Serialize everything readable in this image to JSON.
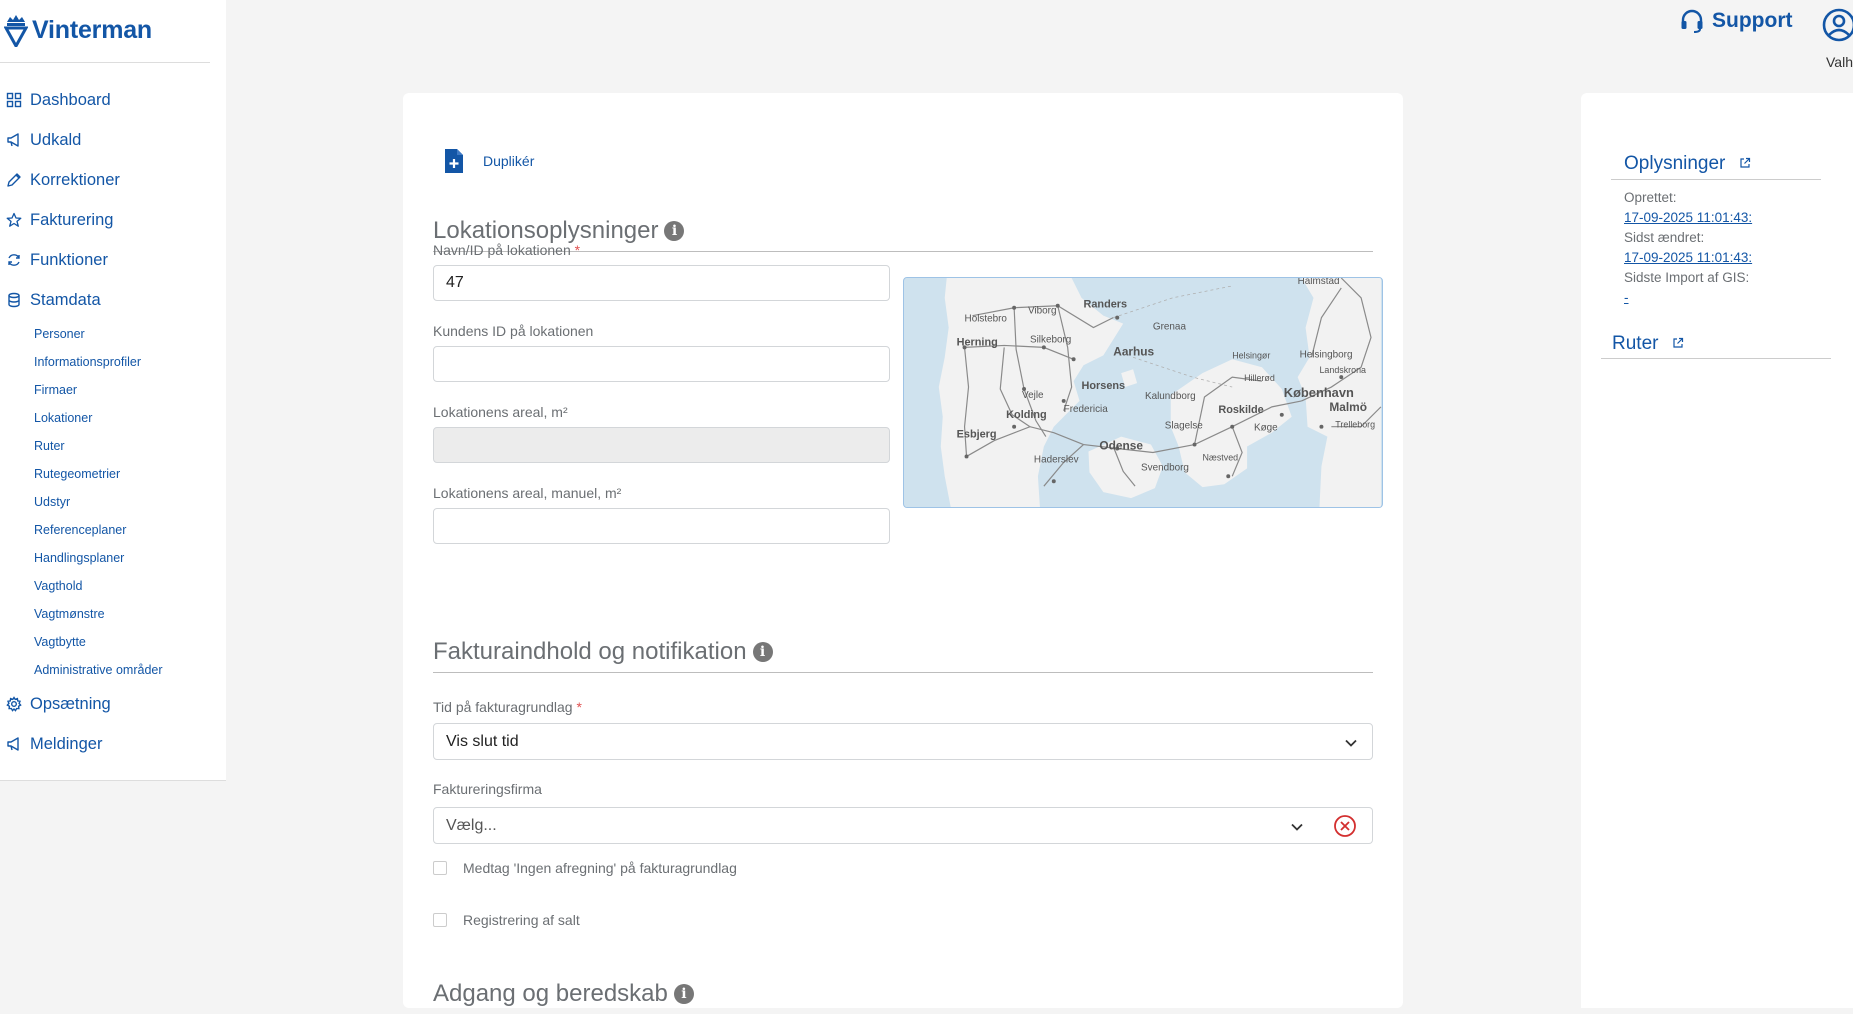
{
  "brand": {
    "name": "Vinterman",
    "color": "#1356a6"
  },
  "header": {
    "support_label": "Support",
    "user_name": "Valh"
  },
  "sidebar": {
    "items": [
      {
        "label": "Dashboard",
        "icon": "grid-icon"
      },
      {
        "label": "Udkald",
        "icon": "megaphone-icon"
      },
      {
        "label": "Korrektioner",
        "icon": "pencil-icon"
      },
      {
        "label": "Fakturering",
        "icon": "star-icon"
      },
      {
        "label": "Funktioner",
        "icon": "refresh-icon"
      },
      {
        "label": "Stamdata",
        "icon": "database-icon"
      }
    ],
    "sub_items": [
      "Personer",
      "Informationsprofiler",
      "Firmaer",
      "Lokationer",
      "Ruter",
      "Rutegeometrier",
      "Udstyr",
      "Referenceplaner",
      "Handlingsplaner",
      "Vagthold",
      "Vagtmønstre",
      "Vagtbytte",
      "Administrative områder"
    ],
    "bottom_items": [
      {
        "label": "Opsætning",
        "icon": "gear-icon"
      },
      {
        "label": "Meldinger",
        "icon": "megaphone-icon"
      }
    ]
  },
  "main": {
    "duplicate_label": "Duplikér",
    "location_section": {
      "title": "Lokationsoplysninger"
    },
    "fields": {
      "name_label": "Navn/ID på lokationen",
      "name_value": "47",
      "customer_id_label": "Kundens ID på lokationen",
      "customer_id_value": "",
      "area_label": "Lokationens areal, m²",
      "area_value": "",
      "area_manual_label": "Lokationens areal, manuel, m²",
      "area_manual_value": ""
    },
    "map_labels": [
      "Halmstad",
      "Holstebro",
      "Viborg",
      "Randers",
      "Grenaa",
      "Herning",
      "Silkeborg",
      "Aarhus",
      "Helsingør",
      "Helsingborg",
      "Hillerød",
      "Landskrona",
      "Horsens",
      "Vejle",
      "Kalundborg",
      "København",
      "Fredericia",
      "Roskilde",
      "Malmö",
      "Kolding",
      "Slagelse",
      "Køge",
      "Trelleborg",
      "Esbjerg",
      "Odense",
      "Haderslev",
      "Næstved",
      "Svendborg"
    ],
    "invoice_section": {
      "title": "Fakturaindhold og notifikation",
      "time_label": "Tid på fakturagrundlag",
      "time_value": "Vis slut tid",
      "company_label": "Faktureringsfirma",
      "company_placeholder": "Vælg...",
      "checkbox1_label": "Medtag 'Ingen afregning' på fakturagrundlag",
      "checkbox2_label": "Registrering af salt"
    },
    "access_section": {
      "title": "Adgang og beredskab"
    }
  },
  "right_panel": {
    "info_title": "Oplysninger",
    "created_label": "Oprettet:",
    "created_value": "17-09-2025 11:01:43:",
    "changed_label": "Sidst ændret:",
    "changed_value": "17-09-2025 11:01:43:",
    "import_label": "Sidste Import af GIS:",
    "import_value": "-",
    "routes_title": "Ruter"
  },
  "colors": {
    "accent": "#1356a6",
    "required": "#e05151",
    "clear": "#d32f2f",
    "map_water": "#cfe2ee",
    "map_land": "#f2f2f2"
  }
}
